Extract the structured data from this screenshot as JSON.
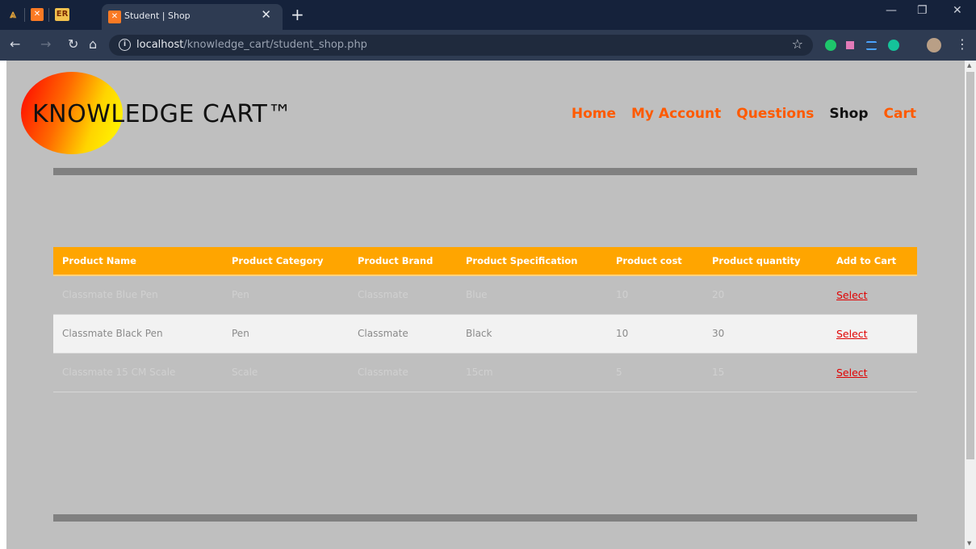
{
  "browser": {
    "tabs": [
      {
        "label": "",
        "icon": "xampp-icon"
      },
      {
        "label": "ER",
        "icon": "er-icon"
      },
      {
        "label": "Student | Shop",
        "icon": "xampp-icon",
        "active": true
      }
    ],
    "close_glyph": "✕",
    "new_tab_glyph": "+",
    "url_host": "localhost",
    "url_path": "/knowledge_cart/student_shop.php"
  },
  "site": {
    "logo": "KNOWLEDGE CART™",
    "nav": [
      {
        "label": "Home",
        "active": false
      },
      {
        "label": "My Account",
        "active": false
      },
      {
        "label": "Questions",
        "active": false
      },
      {
        "label": "Shop",
        "active": true
      },
      {
        "label": "Cart",
        "active": false
      }
    ]
  },
  "table": {
    "headers": [
      "Product Name",
      "Product Category",
      "Product Brand",
      "Product Specification",
      "Product cost",
      "Product quantity",
      "Add to Cart"
    ],
    "rows": [
      {
        "name": "Classmate Blue Pen",
        "category": "Pen",
        "brand": "Classmate",
        "spec": "Blue",
        "cost": "10",
        "quantity": "20",
        "action": "Select"
      },
      {
        "name": "Classmate Black Pen",
        "category": "Pen",
        "brand": "Classmate",
        "spec": "Black",
        "cost": "10",
        "quantity": "30",
        "action": "Select"
      },
      {
        "name": "Classmate 15 CM Scale",
        "category": "Scale",
        "brand": "Classmate",
        "spec": "15cm",
        "cost": "5",
        "quantity": "15",
        "action": "Select"
      }
    ]
  },
  "colors": {
    "nav_link": "#ff5a00",
    "nav_active": "#111111",
    "table_header": "#ffa500",
    "page_bg": "#bfbfbf",
    "select_link": "#e00000"
  }
}
